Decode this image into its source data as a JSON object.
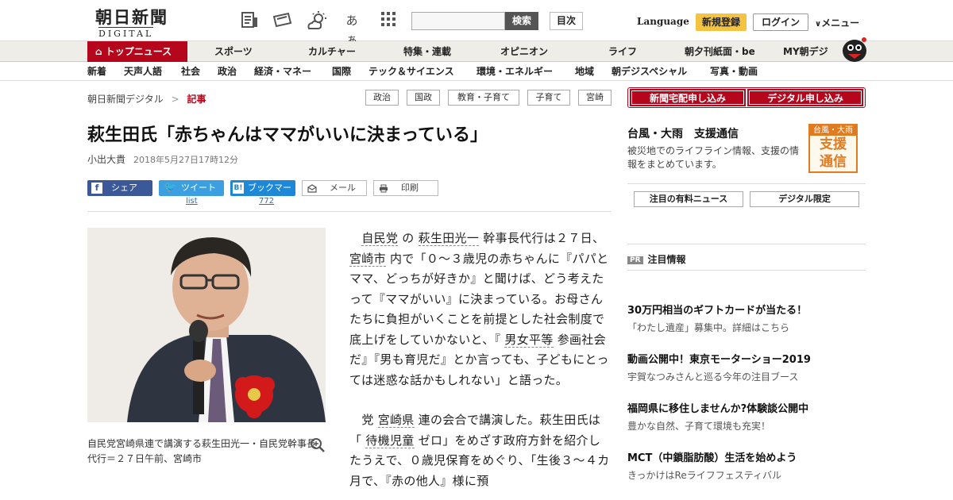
{
  "header": {
    "logo_jp": "朝日新聞",
    "logo_en": "DIGITAL",
    "search_button": "検索",
    "index_button": "目次",
    "language": "Language",
    "register": "新規登録",
    "login": "ログイン",
    "menu": "メニュー",
    "font_size_icon_label": "あぁ"
  },
  "nav_primary": [
    "トップニュース",
    "スポーツ",
    "カルチャー",
    "特集・連載",
    "オピニオン",
    "ライフ",
    "朝夕刊紙面・be",
    "MY朝デジ"
  ],
  "nav_secondary": [
    "新着",
    "天声人語",
    "社会",
    "政治",
    "経済・マネー",
    "国際",
    "テック＆サイエンス",
    "環境・エネルギー",
    "地域",
    "朝デジスペシャル",
    "写真・動画"
  ],
  "breadcrumb": {
    "home": "朝日新聞デジタル",
    "sep": ">",
    "current": "記事"
  },
  "tags": [
    "政治",
    "国政",
    "教育・子育て",
    "子育て",
    "宮崎"
  ],
  "article": {
    "title": "萩生田氏「赤ちゃんはママがいいに決まっている」",
    "author": "小出大貴",
    "date": "2018年5月27日17時12分",
    "share": {
      "facebook": "シェア",
      "twitter": "ツイート",
      "hatena": "ブックマーク",
      "mail": "メール",
      "print": "印刷",
      "twitter_count": "list",
      "hatena_count": "772"
    },
    "caption": "自民党宮崎県連で講演する萩生田光一・自民党幹事長代行＝２７日午前、宮崎市",
    "p1": {
      "a": "自民党",
      "b": " の ",
      "c": "萩生田光一",
      "d": " 幹事長代行は２７日、 ",
      "e": "宮崎市",
      "f": " 内で「０～３歳児の赤ちゃんに『パパとママ、どっちが好きか』と聞けば、どう考えたって『ママがいい』に決まっている。お母さんたちに負担がいくことを前提とした社会制度で底上げをしていかないと、『 ",
      "g": "男女平等",
      "h": " 参画社会だ』『男も育児だ』とか言っても、子どもにとっては迷惑な話かもしれない」と語った。"
    },
    "p2": {
      "a": "党 ",
      "b": "宮崎県",
      "c": " 連の会合で講演した。萩生田氏は「 ",
      "d": "待機児童",
      "e": " ゼロ」をめざす政府方針を紹介したうえで、０歳児保育をめぐり、「生後３～４カ月で、『赤の他人』様に預"
    }
  },
  "sidebar": {
    "btn1": "新聞宅配申し込み",
    "btn2": "デジタル申し込み",
    "support_title": "台風・大雨　支援通信",
    "support_desc": "被災地でのライフライン情報、支援の情報をまとめています。",
    "badge_top": "台風・大雨",
    "badge_main1": "支援",
    "badge_main2": "通信",
    "tab1": "注目の有料ニュース",
    "tab2": "デジタル限定",
    "pr_label": "PR",
    "pr_title": "注目情報",
    "ads": [
      {
        "h": "30万円相当のギフトカードが当たる！",
        "s": "「わたし遺産」募集中。詳細はこちら"
      },
      {
        "h": "動画公開中！東京モーターショー2019",
        "s": "宇賀なつみさんと巡る今年の注目ブース"
      },
      {
        "h": "福岡県に移住しませんか?体験談公開中",
        "s": "豊かな自然、子育て環境も充実！"
      },
      {
        "h": "MCT（中鎖脂肪酸）生活を始めよう",
        "s": "きっかけはReライフフェスティバル"
      }
    ]
  },
  "colors": {
    "brand_red": "#b5061b",
    "accent_yellow": "#f5c342"
  }
}
